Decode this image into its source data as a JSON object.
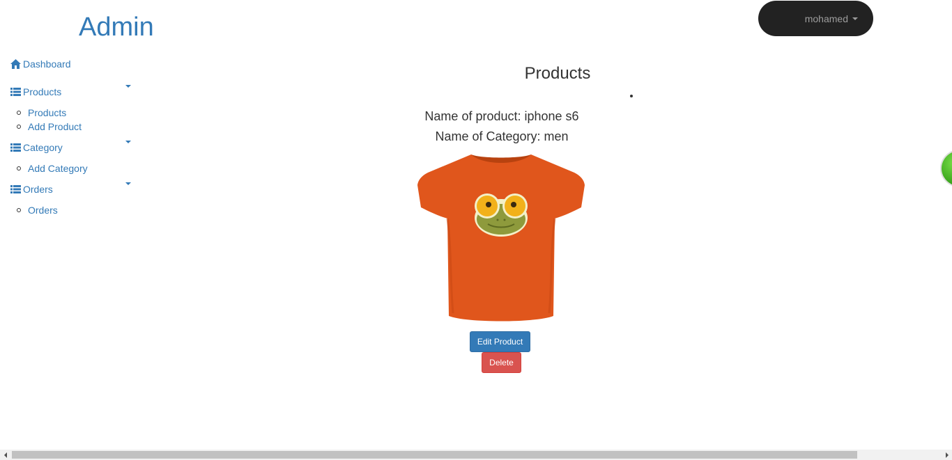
{
  "header": {
    "brand": "Admin",
    "user_name": "mohamed"
  },
  "sidebar": {
    "dashboard": {
      "label": "Dashboard",
      "icon": "home-icon"
    },
    "products": {
      "label": "Products",
      "icon": "list-icon",
      "items": [
        "Products",
        "Add Product"
      ]
    },
    "category": {
      "label": "Category",
      "icon": "list-icon",
      "items": [
        "Add Category"
      ]
    },
    "orders": {
      "label": "Orders",
      "icon": "list-icon",
      "items": [
        "Orders"
      ]
    }
  },
  "main": {
    "title": "Products",
    "product": {
      "name_text": "Name of product: iphone s6",
      "category_text": "Name of Category: men",
      "image": "orange-tshirt-frog-image"
    },
    "buttons": {
      "edit": "Edit Product",
      "delete": "Delete"
    }
  },
  "colors": {
    "link": "#337ab7",
    "navbar": "#222222",
    "primary": "#337ab7",
    "danger": "#d9534f"
  }
}
